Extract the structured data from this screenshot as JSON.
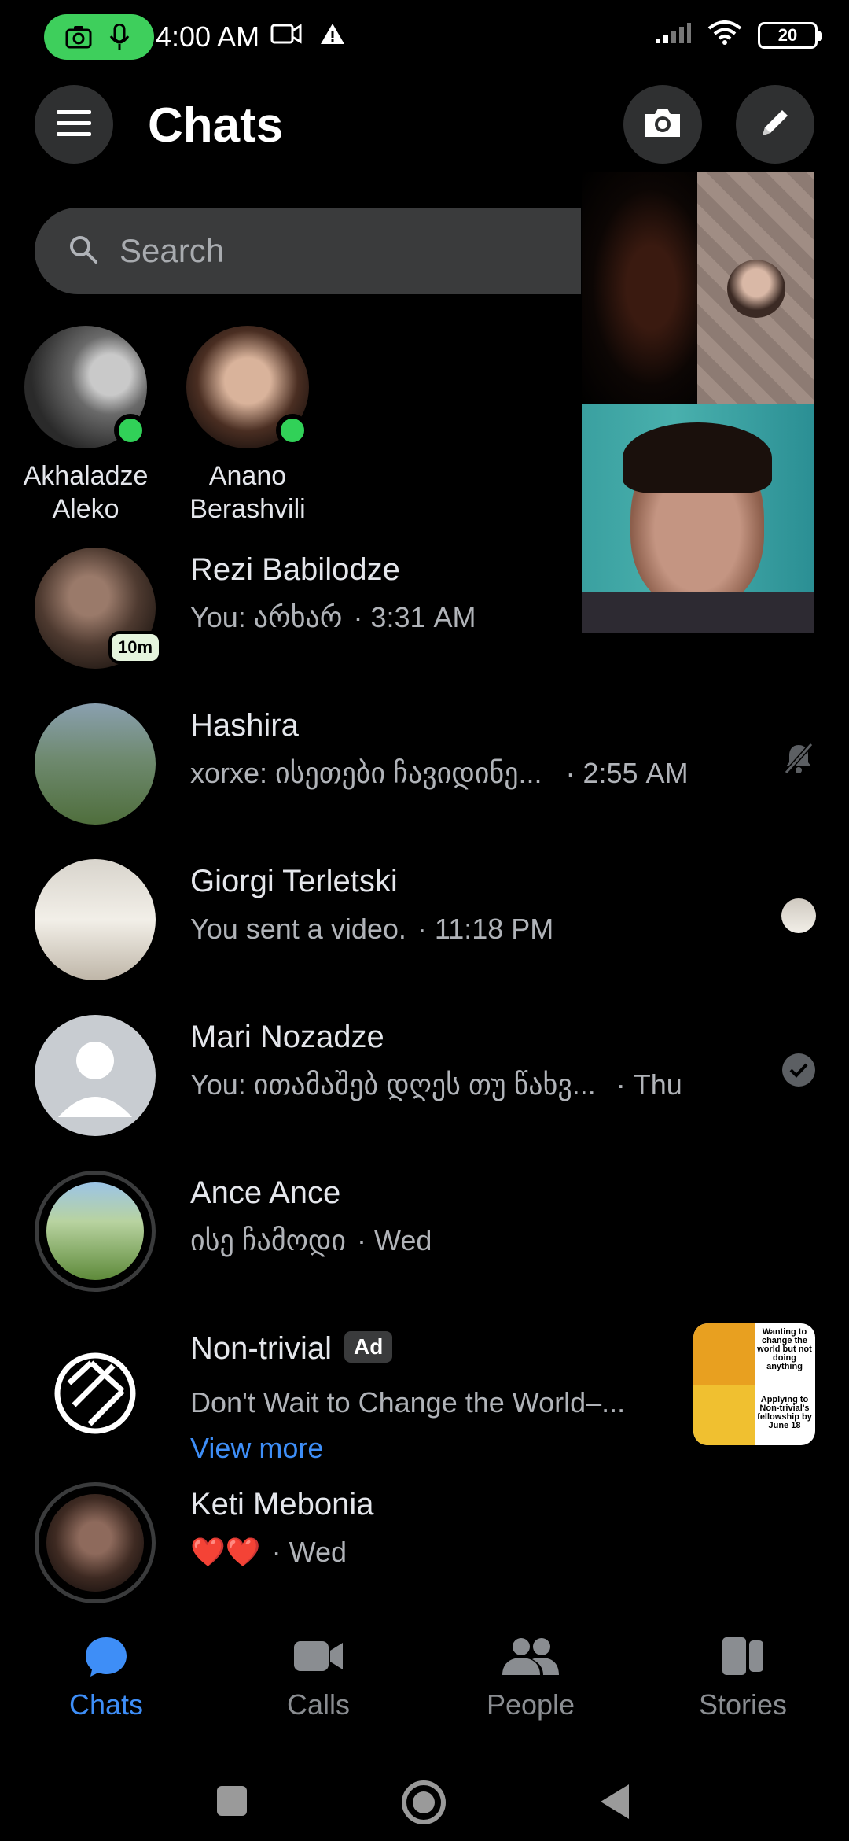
{
  "status_bar": {
    "time": "4:00 AM",
    "battery": "20"
  },
  "header": {
    "title": "Chats"
  },
  "search": {
    "placeholder": "Search"
  },
  "active_contacts": [
    {
      "name": "Akhaladze Aleko"
    },
    {
      "name": "Anano Berashvili"
    }
  ],
  "chats": [
    {
      "name": "Rezi Babilodze",
      "message": "You: არხარ",
      "time": "· 3:31 AM",
      "badge": "10m"
    },
    {
      "name": "Hashira",
      "message": "xorxe: ისეთები ჩავიდინე...",
      "time": "· 2:55 AM"
    },
    {
      "name": "Giorgi Terletski",
      "message": "You sent a video.",
      "time": "· 11:18 PM"
    },
    {
      "name": "Mari Nozadze",
      "message": "You: ითამაშებ დღეს თუ წახვ...",
      "time": "· Thu"
    },
    {
      "name": "Ance Ance",
      "message": "ისე ჩამოდი",
      "time": "· Wed"
    },
    {
      "name": "Non-trivial",
      "ad_label": "Ad",
      "message": "Don't Wait to Change the World–...",
      "link": "View more",
      "thumb_text_top": "Wanting to change the world but not doing anything",
      "thumb_text_bottom": "Applying to Non-trivial's fellowship by June 18"
    },
    {
      "name": "Keti Mebonia",
      "message": "❤️❤️",
      "time": "· Wed"
    }
  ],
  "tabs": [
    {
      "label": "Chats",
      "active": true
    },
    {
      "label": "Calls"
    },
    {
      "label": "People"
    },
    {
      "label": "Stories"
    }
  ],
  "colors": {
    "accent": "#3e8ef7",
    "online": "#31d158",
    "surface": "#3a3b3c"
  }
}
